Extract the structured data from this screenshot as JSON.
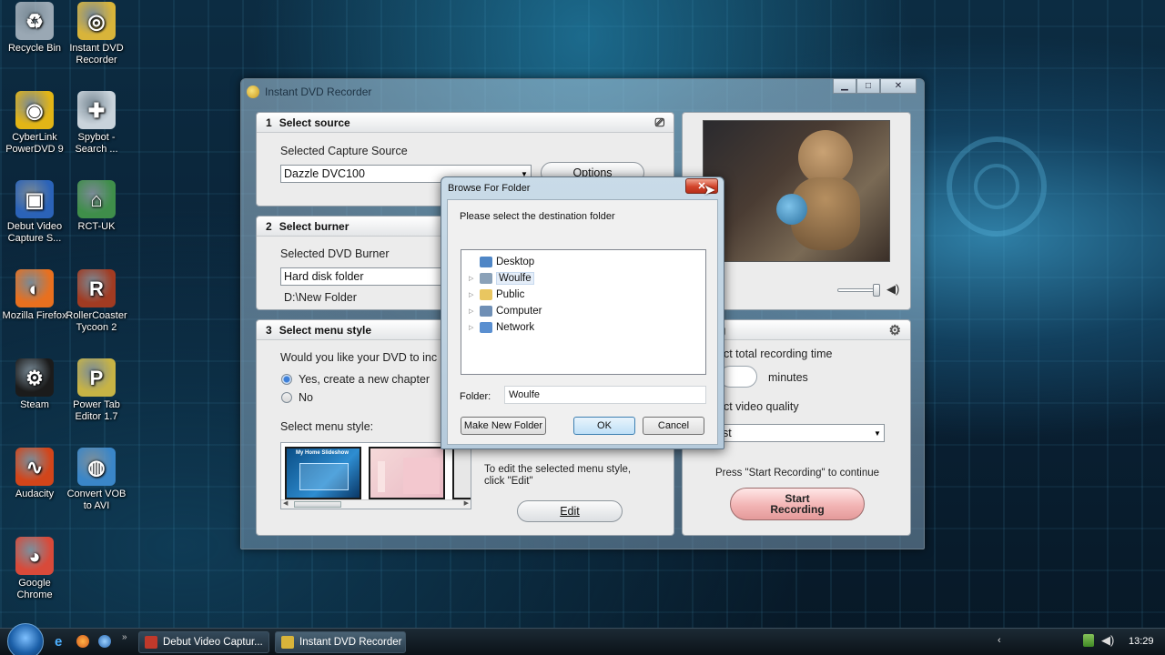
{
  "desktop_icons": [
    {
      "label": "Recycle Bin",
      "icon": "recycle-bin-icon",
      "color": "#9aa8b4"
    },
    {
      "label": "Instant DVD Recorder",
      "icon": "instant-dvd-recorder-icon",
      "color": "#d8b43a"
    },
    {
      "label": "CyberLink PowerDVD 9",
      "icon": "powerdvd-icon",
      "color": "#e2b516"
    },
    {
      "label": "Spybot - Search ...",
      "icon": "spybot-icon",
      "color": "#c9d3db"
    },
    {
      "label": "Debut Video Capture S...",
      "icon": "debut-video-icon",
      "color": "#2b63b8"
    },
    {
      "label": "RCT-UK",
      "icon": "rct-uk-icon",
      "color": "#3f8e4a"
    },
    {
      "label": "Mozilla Firefox",
      "icon": "firefox-icon",
      "color": "#e8701f"
    },
    {
      "label": "RollerCoaster Tycoon 2",
      "icon": "rollercoaster-tycoon-icon",
      "color": "#a13b22"
    },
    {
      "label": "Steam",
      "icon": "steam-icon",
      "color": "#1b1b1b"
    },
    {
      "label": "Power Tab Editor 1.7",
      "icon": "power-tab-icon",
      "color": "#c7b345"
    },
    {
      "label": "Audacity",
      "icon": "audacity-icon",
      "color": "#d2451a"
    },
    {
      "label": "Convert VOB to AVI",
      "icon": "convert-vob-icon",
      "color": "#3a86c8"
    },
    {
      "label": "Google Chrome",
      "icon": "chrome-icon",
      "color": "#d84a3a"
    }
  ],
  "main_window": {
    "title": "Instant DVD Recorder",
    "section1": {
      "number": "1",
      "title": "Select source",
      "capture_label": "Selected Capture Source",
      "capture_value": "Dazzle DVC100",
      "options_button": "Options"
    },
    "section2": {
      "number": "2",
      "title": "Select burner",
      "burner_label": "Selected DVD Burner",
      "burner_value": "Hard disk folder",
      "folder_path": "D:\\New Folder"
    },
    "section3": {
      "number": "3",
      "title": "Select menu style",
      "question": "Would you like your DVD to inc",
      "option_yes": "Yes, create a new chapter",
      "option_no": "No",
      "menu_style_label": "Select menu style:",
      "edit_hint": "To edit the selected menu style, click \"Edit\"",
      "edit_button": "Edit",
      "thumb1_caption": "My Home Slideshow"
    },
    "recording": {
      "title": "ording",
      "total_time_label": "ect total recording time",
      "minutes_label": "minutes",
      "quality_label": "ect video quality",
      "quality_value": "st",
      "continue_hint": "Press \"Start Recording\" to continue",
      "start_button": "Start Recording"
    }
  },
  "dialog": {
    "title": "Browse For Folder",
    "close_label": "✕",
    "instruction": "Please select the destination folder",
    "tree": [
      {
        "label": "Desktop",
        "icon": "desktop-icon",
        "expandable": false,
        "selected": false
      },
      {
        "label": "Woulfe",
        "icon": "user-folder-icon",
        "expandable": true,
        "selected": true
      },
      {
        "label": "Public",
        "icon": "public-folder-icon",
        "expandable": true,
        "selected": false
      },
      {
        "label": "Computer",
        "icon": "computer-icon",
        "expandable": true,
        "selected": false
      },
      {
        "label": "Network",
        "icon": "network-icon",
        "expandable": true,
        "selected": false
      }
    ],
    "folder_label": "Folder:",
    "folder_value": "Woulfe",
    "make_new_folder": "Make New Folder",
    "ok": "OK",
    "cancel": "Cancel"
  },
  "taskbar": {
    "buttons": [
      {
        "label": "Debut Video Captur...",
        "icon": "debut-video-icon"
      },
      {
        "label": "Instant DVD Recorder",
        "icon": "instant-dvd-recorder-icon"
      }
    ],
    "clock": "13:29"
  }
}
